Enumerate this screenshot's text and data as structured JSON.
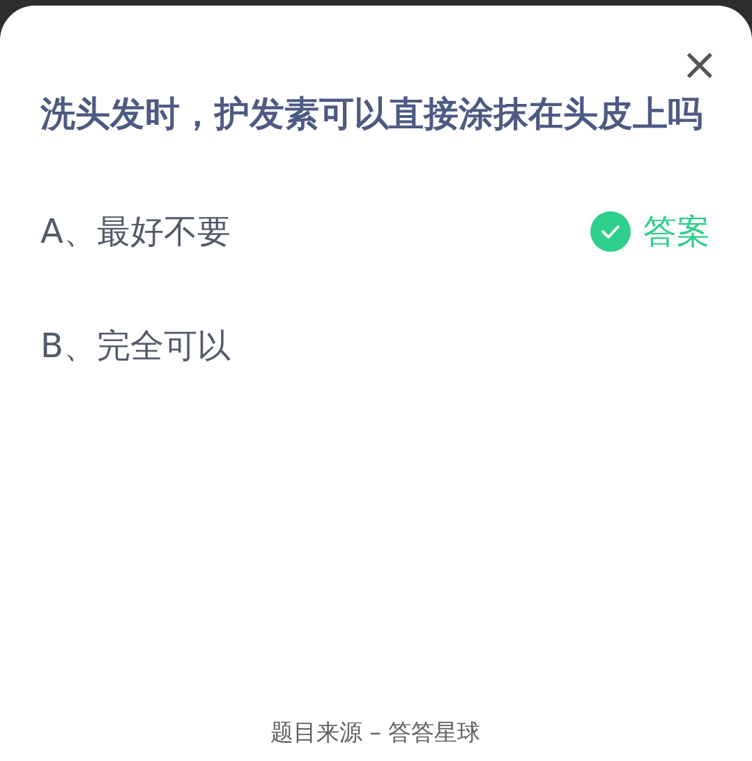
{
  "close_button": "×",
  "question": "洗头发时，护发素可以直接涂抹在头皮上吗",
  "options": [
    {
      "label": "A、最好不要",
      "correct": true
    },
    {
      "label": "B、完全可以",
      "correct": false
    }
  ],
  "answer_label": "答案",
  "footer": "题目来源 – 答答星球"
}
